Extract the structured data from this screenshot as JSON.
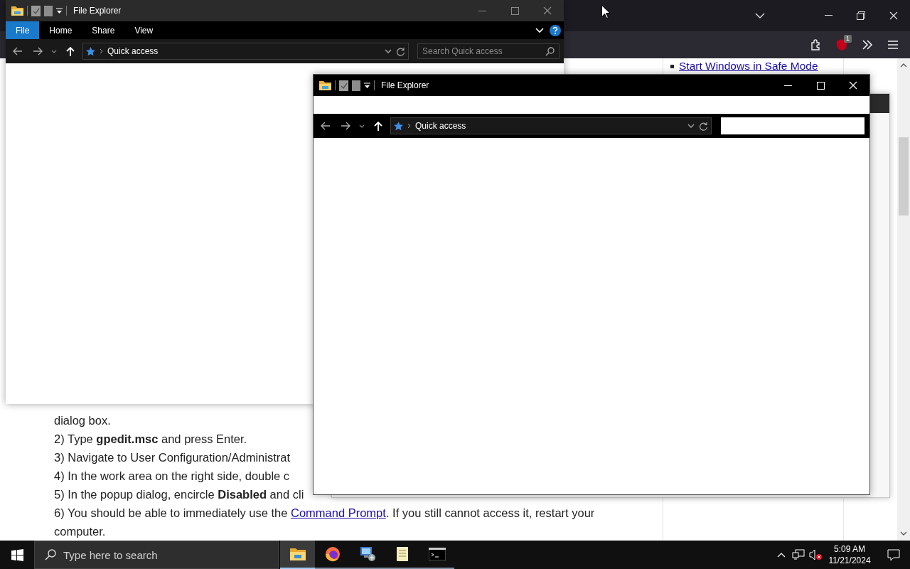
{
  "browser": {
    "toolbar": {
      "badge": "1"
    },
    "sidebar": {
      "links": [
        "Start Windows in Safe Mode"
      ]
    },
    "article_lines": [
      {
        "parts": [
          {
            "kind": "text",
            "text": "dialog box."
          }
        ]
      },
      {
        "parts": [
          {
            "kind": "text",
            "text": "2) Type **gpedit.msc** and press Enter."
          }
        ]
      },
      {
        "parts": [
          {
            "kind": "text",
            "text": "3) Navigate to User Configuration/Administrat"
          }
        ]
      },
      {
        "parts": [
          {
            "kind": "text",
            "text": "4) In the work area on the right side, double c"
          }
        ]
      },
      {
        "parts": [
          {
            "kind": "text",
            "text": "5) In the popup dialog, encircle **Disabled** and cli"
          }
        ]
      },
      {
        "parts": [
          {
            "kind": "text",
            "text": "6) You should be able to immediately use the "
          },
          {
            "kind": "link",
            "text": "Command Prompt"
          },
          {
            "kind": "text",
            "text": ". If you still cannot access it, restart your computer."
          }
        ]
      }
    ]
  },
  "explorer_windows": [
    {
      "title": "File Explorer",
      "active": false,
      "ribbon_tabs": [
        {
          "label": "File",
          "selected": true
        },
        {
          "label": "Home",
          "selected": false
        },
        {
          "label": "Share",
          "selected": false
        },
        {
          "label": "View",
          "selected": false
        }
      ],
      "address": "Quick access",
      "search_placeholder": "Search Quick access"
    },
    {
      "title": "File Explorer",
      "active": true,
      "address": "Quick access"
    }
  ],
  "taskbar": {
    "search_placeholder": "Type here to search",
    "apps": [
      {
        "kind": "explorer",
        "selected": true
      },
      {
        "kind": "firefox",
        "selected": false
      },
      {
        "kind": "network",
        "selected": false
      },
      {
        "kind": "notepad",
        "selected": false
      },
      {
        "kind": "terminal",
        "selected": false
      }
    ],
    "time": "5:09 AM",
    "date": "11/21/2024"
  }
}
